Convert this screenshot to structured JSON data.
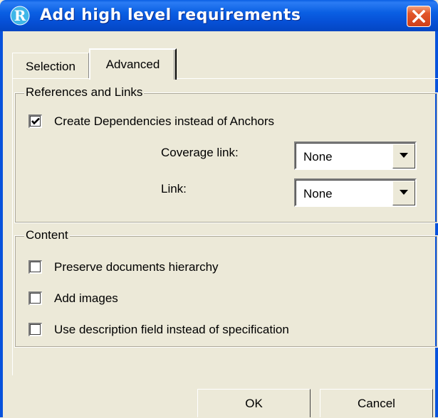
{
  "window": {
    "title": "Add high level requirements",
    "icon": "R",
    "title_bar_color": "#0a5fe3",
    "close_button_color": "#e2562a"
  },
  "tabs": [
    {
      "label": "Selection",
      "selected": false
    },
    {
      "label": "Advanced",
      "selected": true
    }
  ],
  "references_group": {
    "legend": "References and Links",
    "create_dependencies": {
      "label": "Create Dependencies instead of Anchors",
      "checked": true
    },
    "coverage_link": {
      "label": "Coverage link:",
      "value": "None"
    },
    "link": {
      "label": "Link:",
      "value": "None"
    }
  },
  "content_group": {
    "legend": "Content",
    "options": [
      {
        "label": "Preserve documents hierarchy",
        "checked": false
      },
      {
        "label": "Add images",
        "checked": false
      },
      {
        "label": "Use description field instead of specification",
        "checked": false
      }
    ]
  },
  "buttons": {
    "ok": "OK",
    "cancel": "Cancel"
  },
  "icons": {
    "app": "app-r-icon",
    "close": "close-icon",
    "check": "checkmark-icon",
    "dropdown": "chevron-down-icon"
  }
}
